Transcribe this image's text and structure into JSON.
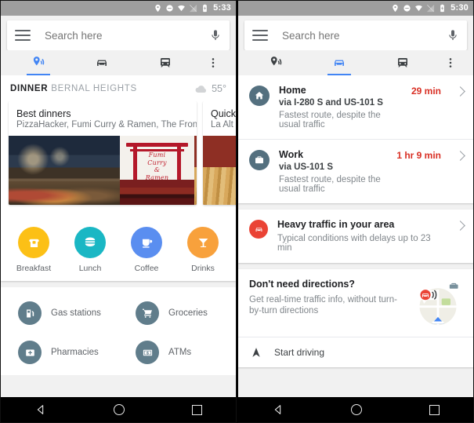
{
  "left": {
    "statusbar": {
      "time": "5:33",
      "icons": [
        "location-pin-icon",
        "do-not-disturb-icon",
        "wifi-icon",
        "cell-signal-icon",
        "battery-icon"
      ]
    },
    "search": {
      "placeholder": "Search here",
      "value": "",
      "menu_icon": "hamburger-menu-icon",
      "mic_icon": "microphone-icon"
    },
    "tabs": [
      {
        "id": "explore",
        "icon": "explore-pin-icon",
        "active": true
      },
      {
        "id": "driving",
        "icon": "car-icon",
        "active": false
      },
      {
        "id": "transit",
        "icon": "train-icon",
        "active": false
      },
      {
        "id": "overflow",
        "icon": "more-vertical-icon",
        "active": false
      }
    ],
    "dinner": {
      "label": "DINNER",
      "neighborhood": "BERNAL HEIGHTS",
      "weather_icon": "cloud-icon",
      "temperature": "55°"
    },
    "place_cards": [
      {
        "title": "Best dinners",
        "subtitle": "PizzaHacker, Fumi Curry & Ramen, The Front…"
      },
      {
        "title": "Quick",
        "subtitle": "La Alt"
      }
    ],
    "categories": [
      {
        "label": "Breakfast",
        "icon": "toast-icon",
        "color": "#fcc016"
      },
      {
        "label": "Lunch",
        "icon": "burger-icon",
        "color": "#1ab7c4"
      },
      {
        "label": "Coffee",
        "icon": "coffee-cup-icon",
        "color": "#5a8ef0"
      },
      {
        "label": "Drinks",
        "icon": "cocktail-icon",
        "color": "#f8a13c"
      }
    ],
    "nearby": [
      {
        "label": "Gas stations",
        "icon": "gas-pump-icon"
      },
      {
        "label": "Groceries",
        "icon": "shopping-cart-icon"
      },
      {
        "label": "Pharmacies",
        "icon": "pharmacy-cross-icon"
      },
      {
        "label": "ATMs",
        "icon": "banknote-icon"
      }
    ],
    "navbar": {
      "back": "back-triangle-icon",
      "home": "home-circle-icon",
      "recents": "recents-square-icon"
    }
  },
  "right": {
    "statusbar": {
      "time": "5:30"
    },
    "search": {
      "placeholder": "Search here",
      "value": ""
    },
    "tabs": [
      {
        "id": "explore",
        "icon": "explore-pin-icon",
        "active": false
      },
      {
        "id": "driving",
        "icon": "car-icon",
        "active": true
      },
      {
        "id": "transit",
        "icon": "train-icon",
        "active": false
      },
      {
        "id": "overflow",
        "icon": "more-vertical-icon",
        "active": false
      }
    ],
    "routes": [
      {
        "name": "Home",
        "icon": "home-icon",
        "via": "via I-280 S and US-101 S",
        "note": "Fastest route, despite the usual traffic",
        "time": "29 min"
      },
      {
        "name": "Work",
        "icon": "briefcase-icon",
        "via": "via US-101 S",
        "note": "Fastest route, despite the usual traffic",
        "time": "1 hr 9 min"
      }
    ],
    "alert": {
      "icon": "traffic-car-icon",
      "title": "Heavy traffic in your area",
      "subtitle": "Typical conditions with delays up to 23 min"
    },
    "promo": {
      "title": "Don't need directions?",
      "subtitle": "Get real-time traffic info, without turn-by-turn directions",
      "illustration": "map-navigation-illustration",
      "action_icon": "navigation-arrow-icon",
      "action_label": "Start driving"
    },
    "accent": "#4285f4",
    "time_color": "#d93025"
  }
}
